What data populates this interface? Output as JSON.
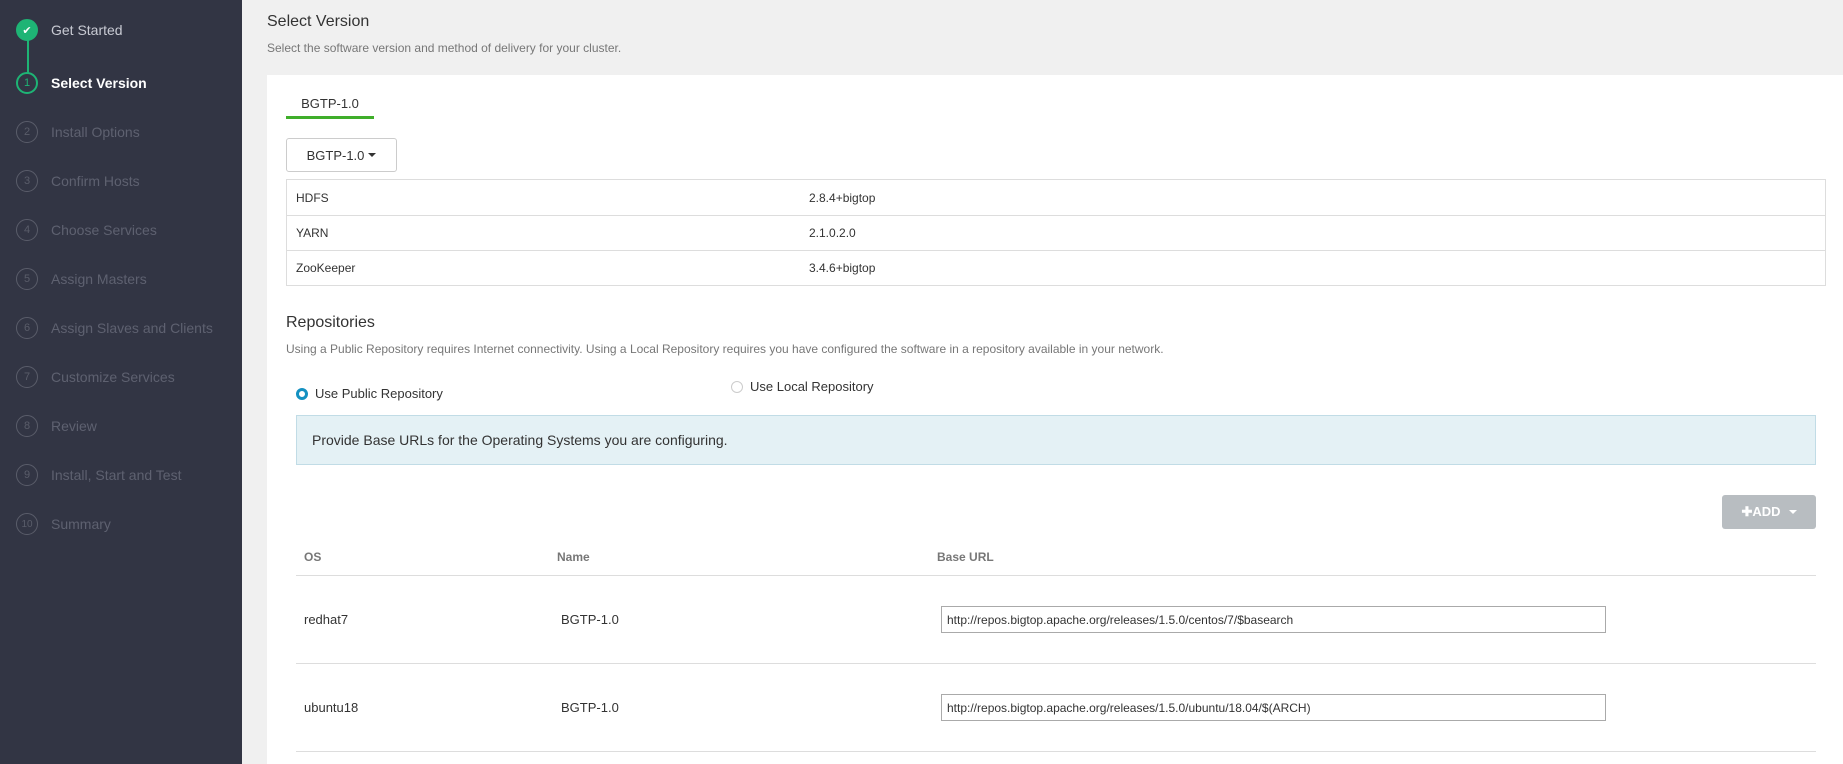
{
  "sidebar": {
    "steps": [
      {
        "num": "✔",
        "label": "Get Started",
        "state": "done"
      },
      {
        "num": "1",
        "label": "Select Version",
        "state": "active"
      },
      {
        "num": "2",
        "label": "Install Options",
        "state": "pending"
      },
      {
        "num": "3",
        "label": "Confirm Hosts",
        "state": "pending"
      },
      {
        "num": "4",
        "label": "Choose Services",
        "state": "pending"
      },
      {
        "num": "5",
        "label": "Assign Masters",
        "state": "pending"
      },
      {
        "num": "6",
        "label": "Assign Slaves and Clients",
        "state": "pending"
      },
      {
        "num": "7",
        "label": "Customize Services",
        "state": "pending"
      },
      {
        "num": "8",
        "label": "Review",
        "state": "pending"
      },
      {
        "num": "9",
        "label": "Install, Start and Test",
        "state": "pending"
      },
      {
        "num": "10",
        "label": "Summary",
        "state": "pending"
      }
    ]
  },
  "header": {
    "title": "Select Version",
    "subtitle": "Select the software version and method of delivery for your cluster."
  },
  "version": {
    "tab_label": "BGTP-1.0",
    "dropdown_label": "BGTP-1.0",
    "services": [
      {
        "name": "HDFS",
        "version": "2.8.4+bigtop"
      },
      {
        "name": "YARN",
        "version": "2.1.0.2.0"
      },
      {
        "name": "ZooKeeper",
        "version": "3.4.6+bigtop"
      }
    ]
  },
  "repositories": {
    "title": "Repositories",
    "description": "Using a Public Repository requires Internet connectivity. Using a Local Repository requires you have configured the software in a repository available in your network.",
    "public_label": "Use Public Repository",
    "local_label": "Use Local Repository",
    "selected": "public",
    "alert_text": "Provide Base URLs for the Operating Systems you are configuring.",
    "add_label": "✚ADD",
    "columns": {
      "os": "OS",
      "name": "Name",
      "base_url": "Base URL"
    },
    "rows": [
      {
        "os": "redhat7",
        "name": "BGTP-1.0",
        "url": "http://repos.bigtop.apache.org/releases/1.5.0/centos/7/$basearch"
      },
      {
        "os": "ubuntu18",
        "name": "BGTP-1.0",
        "url": "http://repos.bigtop.apache.org/releases/1.5.0/ubuntu/18.04/$(ARCH)"
      }
    ]
  },
  "colors": {
    "sidebar_bg": "#323544",
    "accent_green": "#1eb475",
    "tab_underline": "#3fae2a",
    "radio_blue": "#1491c1",
    "alert_bg": "#e4f1f5"
  }
}
